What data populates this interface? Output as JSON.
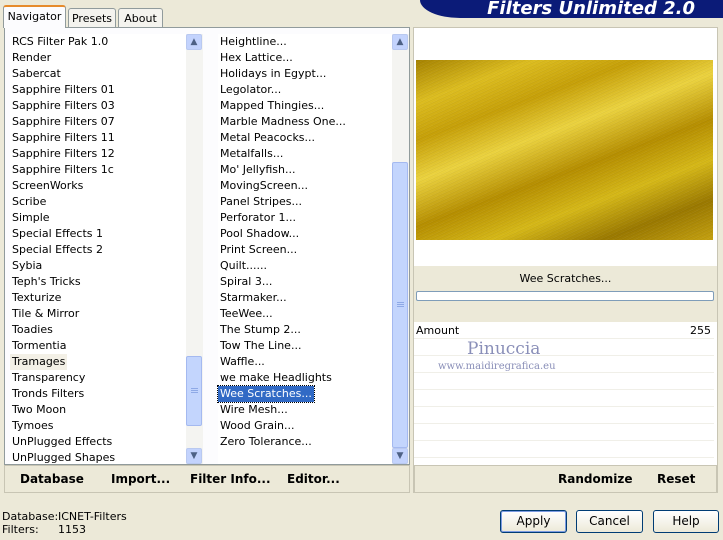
{
  "tabs": [
    "Navigator",
    "Presets",
    "About"
  ],
  "banner_title": "Filters Unlimited 2.0",
  "categories": [
    "RCS Filter Pak 1.0",
    "Render",
    "Sabercat",
    "Sapphire Filters 01",
    "Sapphire Filters 03",
    "Sapphire Filters 07",
    "Sapphire Filters 11",
    "Sapphire Filters 12",
    "Sapphire Filters 1c",
    "ScreenWorks",
    "Scribe",
    "Simple",
    "Special Effects 1",
    "Special Effects 2",
    "Sybia",
    "Teph's Tricks",
    "Texturize",
    "Tile & Mirror",
    "Toadies",
    "Tormentia",
    "Tramages",
    "Transparency",
    "Tronds Filters",
    "Two Moon",
    "Tymoes",
    "UnPlugged Effects",
    "UnPlugged Shapes"
  ],
  "selected_category": "Tramages",
  "filters": [
    "Heightline...",
    "Hex Lattice...",
    "Holidays in Egypt...",
    "Legolator...",
    "Mapped Thingies...",
    "Marble Madness One...",
    "Metal Peacocks...",
    "Metalfalls...",
    "Mo' Jellyfish...",
    "MovingScreen...",
    "Panel Stripes...",
    "Perforator 1...",
    "Pool Shadow...",
    "Print Screen...",
    "Quilt......",
    "Spiral 3...",
    "Starmaker...",
    "TeeWee...",
    "The Stump 2...",
    "Tow The Line...",
    "Waffle...",
    "we make Headlights",
    "Wee Scratches...",
    "Wire Mesh...",
    "Wood Grain...",
    "Zero Tolerance..."
  ],
  "selected_filter": "Wee Scratches...",
  "toolbar": {
    "database": "Database",
    "import": "Import...",
    "filter_info": "Filter Info...",
    "editor": "Editor...",
    "randomize": "Randomize",
    "reset": "Reset"
  },
  "filter_name": "Wee Scratches...",
  "progress": 0,
  "parameters": [
    {
      "label": "Amount",
      "value": "255"
    }
  ],
  "watermark": {
    "name": "Pinuccia",
    "site": "www.maidiregrafica.eu"
  },
  "status": {
    "database_label": "Database:",
    "database_value": "ICNET-Filters",
    "filters_label": "Filters:",
    "filters_value": "1153"
  },
  "buttons": {
    "apply": "Apply",
    "cancel": "Cancel",
    "help": "Help"
  },
  "colors": {
    "banner": "#0b1b78",
    "selection": "#316ac5",
    "preview_gold": "#d4b410"
  }
}
